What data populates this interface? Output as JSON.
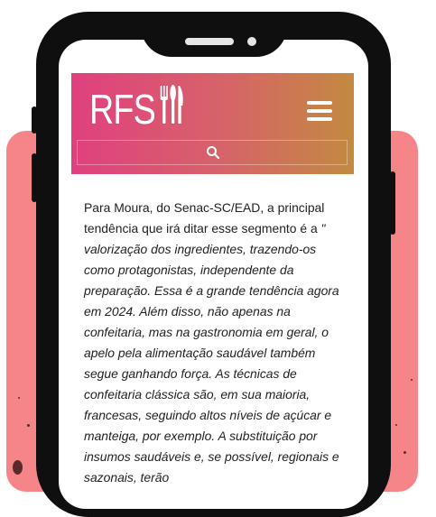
{
  "header": {
    "logo_text": "RFS",
    "logo_icon": "utensils-icon",
    "menu_icon": "hamburger-menu-icon",
    "search_icon": "search-icon"
  },
  "article": {
    "intro": "Para Moura, do Senac-SC/EAD, a principal tendência que irá ditar esse segmento é a",
    "quote": "\" valorização dos ingredientes, trazendo-os como protagonistas, independente da preparação. Essa é a grande tendência agora em 2024. Além disso, não apenas na confeitaria, mas na gastronomia em geral, o apelo pela alimentação saudável também segue ganhando força. As técnicas de confeitaria clássica são, em sua maioria, francesas, seguindo altos níveis de açúcar e manteiga, por exemplo. A substituição por insumos saudáveis e, se possível, regionais e sazonais, terão"
  },
  "colors": {
    "header_gradient_start": "#e0407f",
    "header_gradient_end": "#c38a40",
    "background_accent": "#f6858a",
    "phone_frame": "#0f0f0f"
  }
}
